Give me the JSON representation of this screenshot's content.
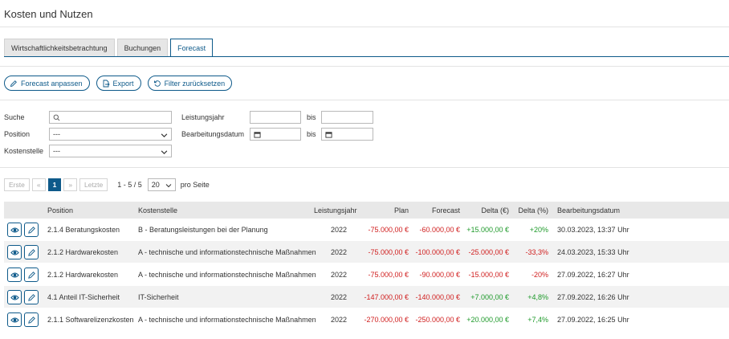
{
  "page": {
    "title": "Kosten und Nutzen"
  },
  "tabs": [
    {
      "label": "Wirtschaftlichkeitsbetrachtung",
      "active": false
    },
    {
      "label": "Buchungen",
      "active": false
    },
    {
      "label": "Forecast",
      "active": true
    }
  ],
  "actions": {
    "forecast_label": "Forecast anpassen",
    "export_label": "Export",
    "reset_label": "Filter zurücksetzen"
  },
  "filters": {
    "search_label": "Suche",
    "search_value": "",
    "position_label": "Position",
    "position_value": "---",
    "kostenstelle_label": "Kostenstelle",
    "kostenstelle_value": "---",
    "leistungsjahr_label": "Leistungsjahr",
    "bis_label": "bis",
    "bearbeitungsdatum_label": "Bearbeitungsdatum"
  },
  "pagination": {
    "first": "Erste",
    "prev": "«",
    "current": "1",
    "next": "»",
    "last": "Letzte",
    "range": "1 - 5 / 5",
    "per_page": "20",
    "per_page_label": "pro Seite"
  },
  "table": {
    "columns": {
      "position": "Position",
      "kostenstelle": "Kostenstelle",
      "leistungsjahr": "Leistungsjahr",
      "plan": "Plan",
      "forecast": "Forecast",
      "delta_eur": "Delta (€)",
      "delta_pct": "Delta (%)",
      "datum": "Bearbeitungsdatum"
    },
    "rows": [
      {
        "position": "2.1.4 Beratungskosten",
        "kostenstelle": "B - Beratungsleistungen bei der Planung",
        "jahr": "2022",
        "plan": "-75.000,00 €",
        "forecast": "-60.000,00 €",
        "delta_eur": "+15.000,00 €",
        "delta_pct": "+20%",
        "datum": "30.03.2023, 13:37 Uhr"
      },
      {
        "position": "2.1.2 Hardwarekosten",
        "kostenstelle": "A - technische und informationstechnische Maßnahmen",
        "jahr": "2022",
        "plan": "-75.000,00 €",
        "forecast": "-100.000,00 €",
        "delta_eur": "-25.000,00 €",
        "delta_pct": "-33,3%",
        "datum": "24.03.2023, 15:33 Uhr"
      },
      {
        "position": "2.1.2 Hardwarekosten",
        "kostenstelle": "A - technische und informationstechnische Maßnahmen",
        "jahr": "2022",
        "plan": "-75.000,00 €",
        "forecast": "-90.000,00 €",
        "delta_eur": "-15.000,00 €",
        "delta_pct": "-20%",
        "datum": "27.09.2022, 16:27 Uhr"
      },
      {
        "position": "4.1 Anteil IT-Sicherheit",
        "kostenstelle": "IT-Sicherheit",
        "jahr": "2022",
        "plan": "-147.000,00 €",
        "forecast": "-140.000,00 €",
        "delta_eur": "+7.000,00 €",
        "delta_pct": "+4,8%",
        "datum": "27.09.2022, 16:26 Uhr"
      },
      {
        "position": "2.1.1 Softwarelizenzkosten",
        "kostenstelle": "A - technische und informationstechnische Maßnahmen",
        "jahr": "2022",
        "plan": "-270.000,00 €",
        "forecast": "-250.000,00 €",
        "delta_eur": "+20.000,00 €",
        "delta_pct": "+7,4%",
        "datum": "27.09.2022, 16:25 Uhr"
      }
    ]
  },
  "colors": {
    "accent": "#0e5a8a",
    "negative": "#d01e1e",
    "positive": "#1f9a2b"
  },
  "icons": {
    "row_view": "eye-icon",
    "row_edit": "pencil-icon",
    "search": "search-icon",
    "calendar": "calendar-icon",
    "select": "chevron-down-icon"
  }
}
